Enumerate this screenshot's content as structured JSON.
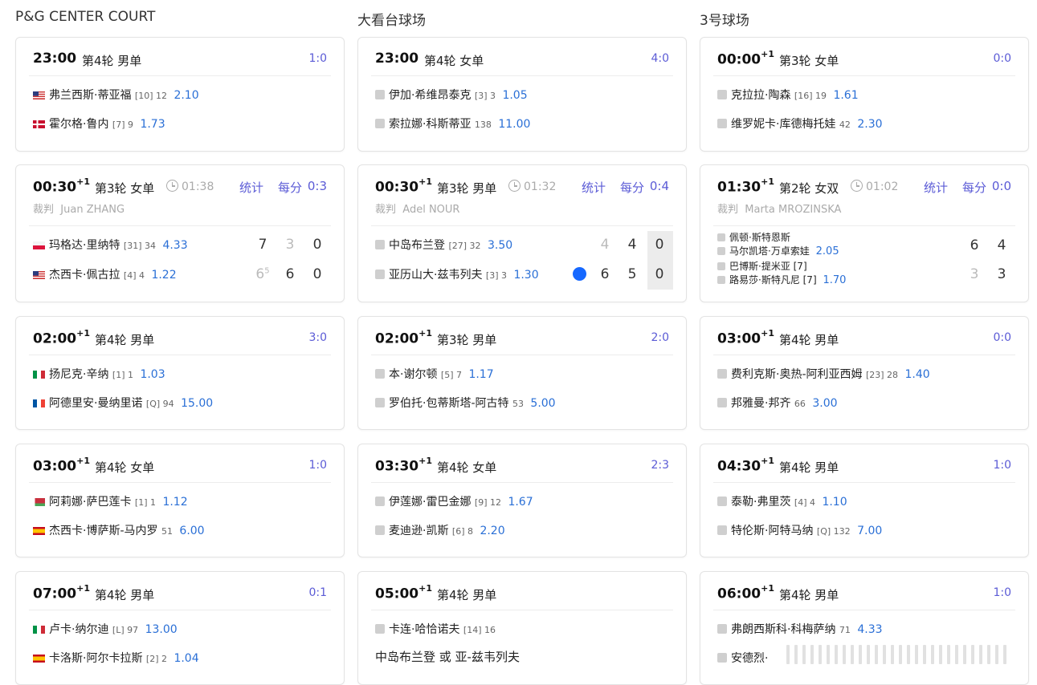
{
  "courts": [
    {
      "title": "P&G CENTER COURT",
      "matches": [
        {
          "time": "23:00",
          "day": "",
          "round": "第4轮 男单",
          "score": "1:0",
          "players": [
            {
              "flag": "us",
              "name": "弗兰西斯·蒂亚福",
              "seed": "[10] 12",
              "odds": "2.10"
            },
            {
              "flag": "dk",
              "name": "霍尔格·鲁内",
              "seed": "[7] 9",
              "odds": "1.73"
            }
          ]
        },
        {
          "time": "00:30",
          "day": "+1",
          "round": "第3轮 女单",
          "elapsed": "01:38",
          "stats": "统计",
          "pbp": "每分",
          "score": "0:3",
          "umpire_label": "裁判",
          "umpire": "Juan ZHANG",
          "players": [
            {
              "flag": "pl",
              "name": "玛格达·里纳特",
              "seed": "[31] 34",
              "odds": "4.33",
              "sets": [
                "7",
                "3",
                "0"
              ]
            },
            {
              "flag": "us",
              "name": "杰西卡·佩古拉",
              "seed": "[4] 4",
              "odds": "1.22",
              "sets": [
                "6",
                "6",
                "0"
              ],
              "tb": "5"
            }
          ]
        },
        {
          "time": "02:00",
          "day": "+1",
          "round": "第4轮 男单",
          "score": "3:0",
          "players": [
            {
              "flag": "it",
              "name": "扬尼克·辛纳",
              "seed": "[1] 1",
              "odds": "1.03"
            },
            {
              "flag": "fr",
              "name": "阿德里安·曼纳里诺",
              "seed": "[Q] 94",
              "odds": "15.00"
            }
          ]
        },
        {
          "time": "03:00",
          "day": "+1",
          "round": "第4轮 女单",
          "score": "1:0",
          "players": [
            {
              "flag": "by",
              "name": "阿莉娜·萨巴莲卡",
              "seed": "[1] 1",
              "odds": "1.12"
            },
            {
              "flag": "es",
              "name": "杰西卡·博萨斯-马内罗",
              "seed": "51",
              "odds": "6.00"
            }
          ]
        },
        {
          "time": "07:00",
          "day": "+1",
          "round": "第4轮 男单",
          "score": "0:1",
          "players": [
            {
              "flag": "it",
              "name": "卢卡·纳尔迪",
              "seed": "[L] 97",
              "odds": "13.00"
            },
            {
              "flag": "es",
              "name": "卡洛斯·阿尔卡拉斯",
              "seed": "[2] 2",
              "odds": "1.04"
            }
          ]
        }
      ]
    },
    {
      "title": "大看台球场",
      "matches": [
        {
          "time": "23:00",
          "day": "",
          "round": "第4轮 女单",
          "score": "4:0",
          "players": [
            {
              "flag": "gray",
              "name": "伊加·希维昂泰克",
              "seed": "[3] 3",
              "odds": "1.05"
            },
            {
              "flag": "gray",
              "name": "索拉娜·科斯蒂亚",
              "seed": "138",
              "odds": "11.00"
            }
          ]
        },
        {
          "time": "00:30",
          "day": "+1",
          "round": "第3轮 男单",
          "elapsed": "01:32",
          "stats": "统计",
          "pbp": "每分",
          "score": "0:4",
          "umpire_label": "裁判",
          "umpire": "Adel NOUR",
          "players": [
            {
              "flag": "gray",
              "name": "中岛布兰登",
              "seed": "[27] 32",
              "odds": "3.50",
              "sets": [
                "4",
                "4",
                "0"
              ]
            },
            {
              "flag": "gray",
              "name": "亚历山大·兹韦列夫",
              "seed": "[3] 3",
              "odds": "1.30",
              "sets": [
                "6",
                "5",
                "0"
              ],
              "serving": true
            }
          ]
        },
        {
          "time": "02:00",
          "day": "+1",
          "round": "第3轮 男单",
          "score": "2:0",
          "players": [
            {
              "flag": "gray",
              "name": "本·谢尔顿",
              "seed": "[5] 7",
              "odds": "1.17"
            },
            {
              "flag": "gray",
              "name": "罗伯托·包蒂斯塔-阿古特",
              "seed": "53",
              "odds": "5.00"
            }
          ]
        },
        {
          "time": "03:30",
          "day": "+1",
          "round": "第4轮 女单",
          "score": "2:3",
          "players": [
            {
              "flag": "gray",
              "name": "伊莲娜·雷巴金娜",
              "seed": "[9] 12",
              "odds": "1.67"
            },
            {
              "flag": "gray",
              "name": "麦迪逊·凯斯",
              "seed": "[6] 8",
              "odds": "2.20"
            }
          ]
        },
        {
          "time": "05:00",
          "day": "+1",
          "round": "第4轮 男单",
          "players": [
            {
              "flag": "gray",
              "name": "卡连·哈恰诺夫",
              "seed": "[14] 16",
              "odds": ""
            }
          ],
          "note": "中岛布兰登 或 亚-兹韦列夫"
        }
      ]
    },
    {
      "title": "3号球场",
      "matches": [
        {
          "time": "00:00",
          "day": "+1",
          "round": "第3轮 女单",
          "score": "0:0",
          "players": [
            {
              "flag": "gray",
              "name": "克拉拉·陶森",
              "seed": "[16] 19",
              "odds": "1.61"
            },
            {
              "flag": "gray",
              "name": "维罗妮卡·库德梅托娃",
              "seed": "42",
              "odds": "2.30"
            }
          ]
        },
        {
          "time": "01:30",
          "day": "+1",
          "round": "第2轮 女双",
          "elapsed": "01:02",
          "stats": "统计",
          "pbp": "每分",
          "score": "0:0",
          "umpire_label": "裁判",
          "umpire": "Marta MROZINSKA",
          "teams": [
            {
              "p1": "佩顿·斯特恩斯",
              "p2": "马尔凯塔·万卓索娃",
              "seed": "",
              "odds": "2.05",
              "sets": [
                "6",
                "4"
              ]
            },
            {
              "p1": "巴博斯·提米亚 [7]",
              "p2": "路易莎·斯特凡尼 [7]",
              "seed": "",
              "odds": "1.70",
              "sets": [
                "3",
                "3"
              ]
            }
          ]
        },
        {
          "time": "03:00",
          "day": "+1",
          "round": "第4轮 男单",
          "score": "0:0",
          "players": [
            {
              "flag": "gray",
              "name": "费利克斯·奥热-阿利亚西姆",
              "seed": "[23] 28",
              "odds": "1.40"
            },
            {
              "flag": "gray",
              "name": "邦雅曼·邦齐",
              "seed": "66",
              "odds": "3.00"
            }
          ]
        },
        {
          "time": "04:30",
          "day": "+1",
          "round": "第4轮 男单",
          "score": "1:0",
          "players": [
            {
              "flag": "gray",
              "name": "泰勒·弗里茨",
              "seed": "[4] 4",
              "odds": "1.10"
            },
            {
              "flag": "gray",
              "name": "特伦斯·阿特马纳",
              "seed": "[Q] 132",
              "odds": "7.00"
            }
          ]
        },
        {
          "time": "06:00",
          "day": "+1",
          "round": "第4轮 男单",
          "score": "1:0",
          "players": [
            {
              "flag": "gray",
              "name": "弗朗西斯科·科梅萨纳",
              "seed": "71",
              "odds": "4.33"
            },
            {
              "flag": "gray",
              "name": "安德烈·",
              "seed": "",
              "odds": ""
            }
          ]
        }
      ]
    }
  ]
}
